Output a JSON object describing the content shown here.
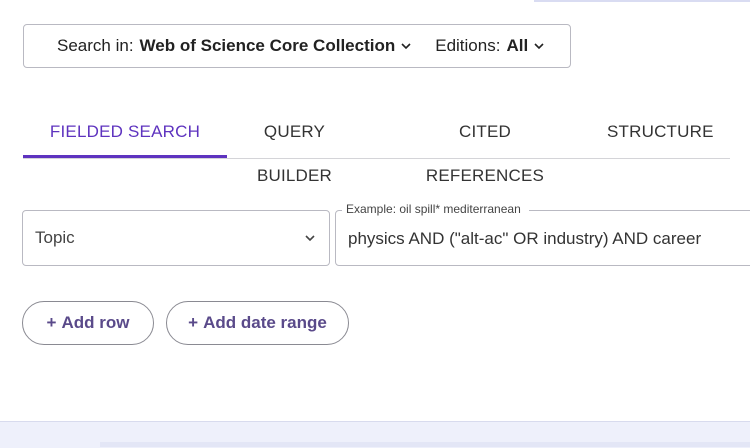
{
  "collection_bar": {
    "search_in_label": "Search in:",
    "search_in_value": "Web of Science Core Collection",
    "editions_label": "Editions:",
    "editions_value": "All"
  },
  "tabs": [
    {
      "label": "FIELDED SEARCH",
      "active": true
    },
    {
      "label": "QUERY BUILDER",
      "active": false
    },
    {
      "label": "CITED REFERENCES",
      "active": false
    },
    {
      "label": "STRUCTURE",
      "active": false
    }
  ],
  "search_row": {
    "field_value": "Topic",
    "query_example": "Example: oil spill* mediterranean",
    "query_value": "physics AND (\"alt-ac\" OR industry) AND career"
  },
  "actions": {
    "add_row_label": "Add row",
    "add_date_range_label": "Add date range",
    "plus_symbol": "+"
  },
  "colors": {
    "accent": "#5e33bf",
    "border": "#b9b9c2",
    "pill_text": "#5a4a8a"
  }
}
